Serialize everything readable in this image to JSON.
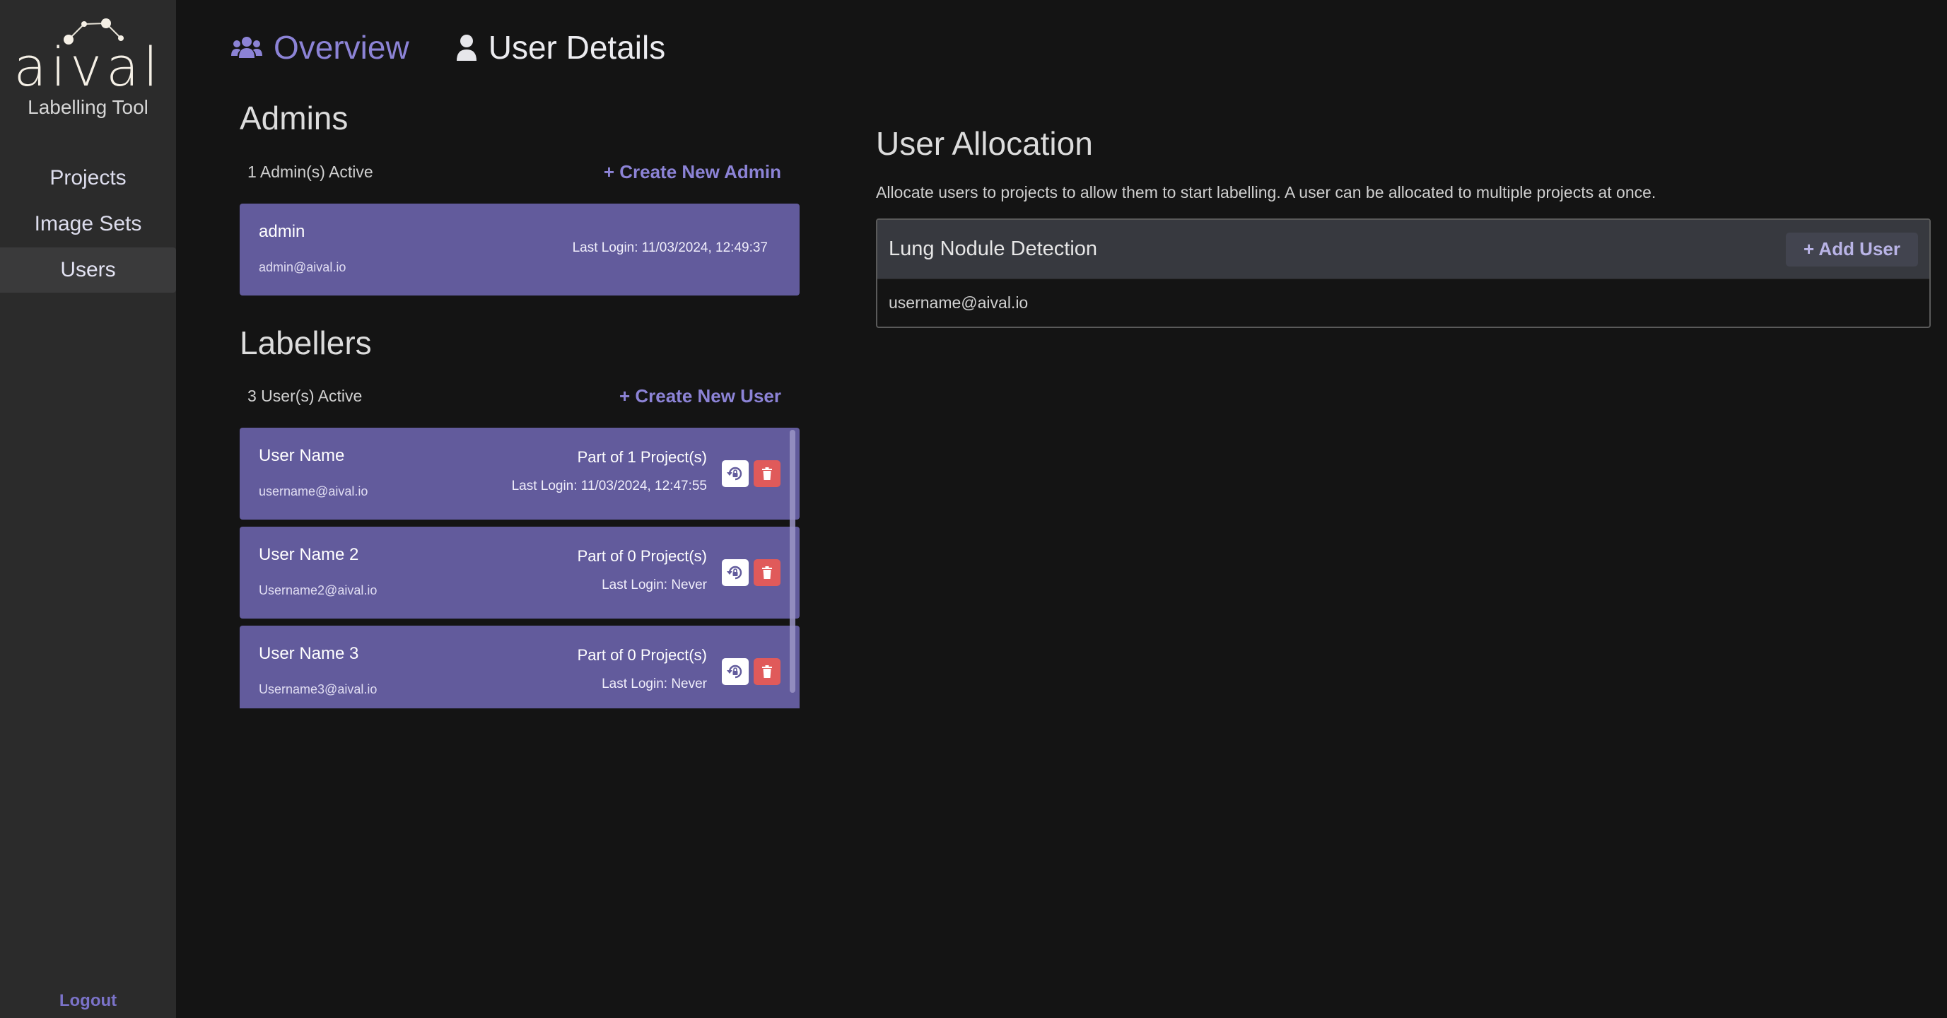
{
  "app": {
    "logo_text": "aival",
    "subtitle": "Labelling Tool"
  },
  "sidebar": {
    "items": [
      {
        "label": "Projects",
        "active": false
      },
      {
        "label": "Image Sets",
        "active": false
      },
      {
        "label": "Users",
        "active": true
      }
    ],
    "logout_label": "Logout"
  },
  "tabs": [
    {
      "label": "Overview",
      "icon": "users-group-icon",
      "active": true
    },
    {
      "label": "User Details",
      "icon": "user-icon",
      "active": false
    }
  ],
  "admins": {
    "title": "Admins",
    "count_text": "1 Admin(s) Active",
    "create_label": "+ Create New Admin",
    "list": [
      {
        "name": "admin",
        "email": "admin@aival.io",
        "last_login": "Last Login: 11/03/2024, 12:49:37"
      }
    ]
  },
  "labellers": {
    "title": "Labellers",
    "count_text": "3 User(s) Active",
    "create_label": "+ Create New User",
    "list": [
      {
        "name": "User Name",
        "email": "username@aival.io",
        "projects": "Part of 1 Project(s)",
        "last_login": "Last Login: 11/03/2024, 12:47:55"
      },
      {
        "name": "User Name 2",
        "email": "Username2@aival.io",
        "projects": "Part of 0 Project(s)",
        "last_login": "Last Login: Never"
      },
      {
        "name": "User Name 3",
        "email": "Username3@aival.io",
        "projects": "Part of 0 Project(s)",
        "last_login": "Last Login: Never"
      }
    ]
  },
  "allocation": {
    "title": "User Allocation",
    "description": "Allocate users to projects to allow them to start labelling. A user can be allocated to multiple projects at once.",
    "projects": [
      {
        "name": "Lung Nodule Detection",
        "add_label": "+ Add User",
        "users": [
          "username@aival.io"
        ]
      }
    ]
  },
  "colors": {
    "accent": "#8c83d6",
    "card": "#625b9c",
    "delete": "#e05a5a",
    "sidebar": "#2b2b2b",
    "background": "#141414"
  }
}
